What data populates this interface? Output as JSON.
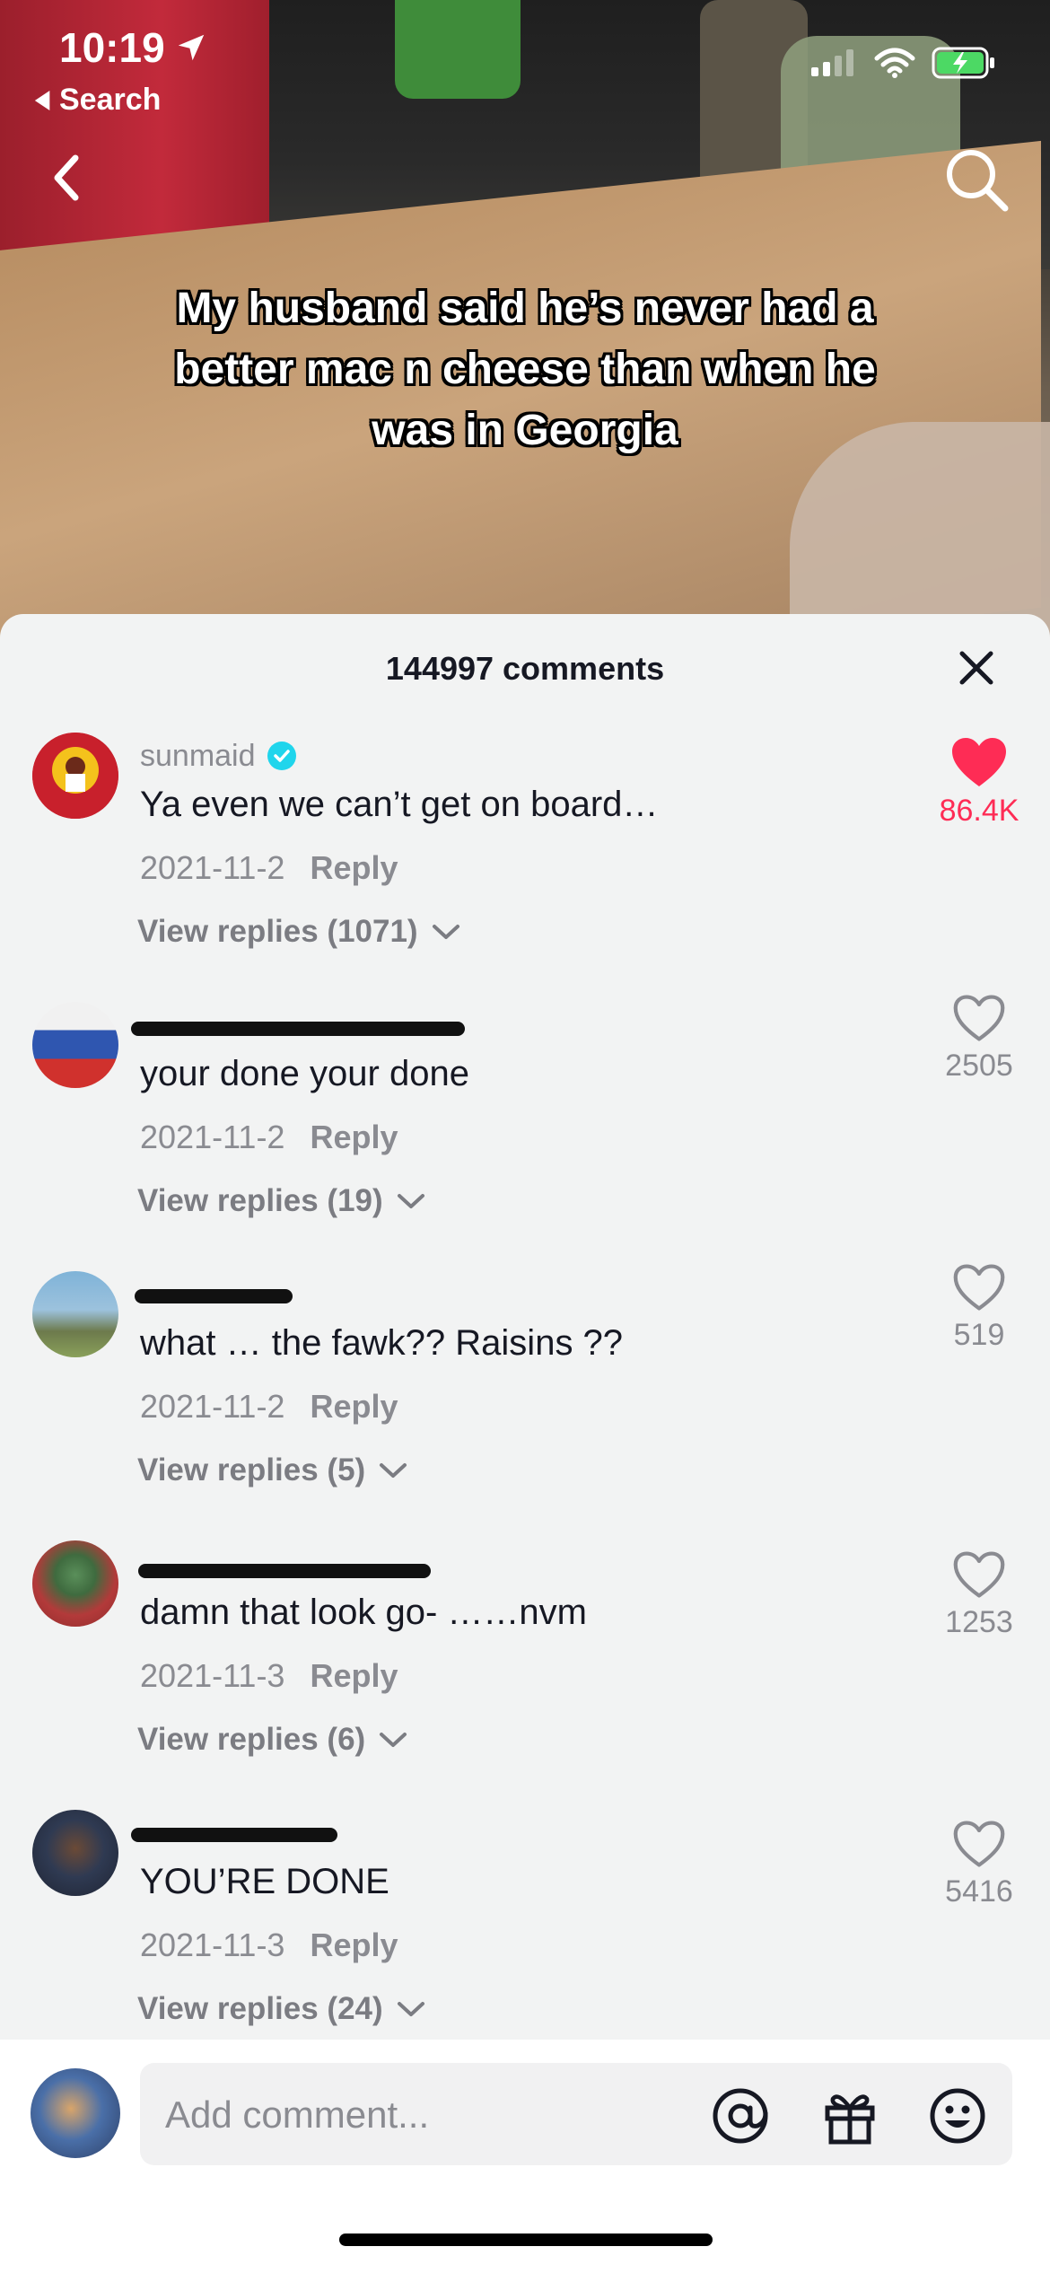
{
  "status_bar": {
    "time": "10:19",
    "back_label": "Search"
  },
  "video": {
    "caption": "My husband said he’s never had a better mac n cheese than when he was in Georgia"
  },
  "comments_header": {
    "title": "144997 comments"
  },
  "comments": [
    {
      "username": "sunmaid",
      "verified": true,
      "text": "Ya even we can’t get on board…",
      "date": "2021-11-2",
      "reply_label": "Reply",
      "view_replies": "View replies (1071)",
      "likes": "86.4K",
      "liked": true
    },
    {
      "username": "",
      "text": "your done your done",
      "date": "2021-11-2",
      "reply_label": "Reply",
      "view_replies": "View replies (19)",
      "likes": "2505",
      "liked": false
    },
    {
      "username": "",
      "text": "what … the fawk?? Raisins ??",
      "date": "2021-11-2",
      "reply_label": "Reply",
      "view_replies": "View replies (5)",
      "likes": "519",
      "liked": false
    },
    {
      "username": "",
      "text": "damn that look go- ……nvm",
      "date": "2021-11-3",
      "reply_label": "Reply",
      "view_replies": "View replies (6)",
      "likes": "1253",
      "liked": false
    },
    {
      "username": "",
      "text": "YOU’RE DONE",
      "date": "2021-11-3",
      "reply_label": "Reply",
      "view_replies": "View replies (24)",
      "likes": "5416",
      "liked": false
    }
  ],
  "comment_input": {
    "placeholder": "Add comment..."
  },
  "colors": {
    "like_active": "#fe2c55",
    "verified": "#20d5ec",
    "sheet_bg": "#f2f3f3"
  }
}
